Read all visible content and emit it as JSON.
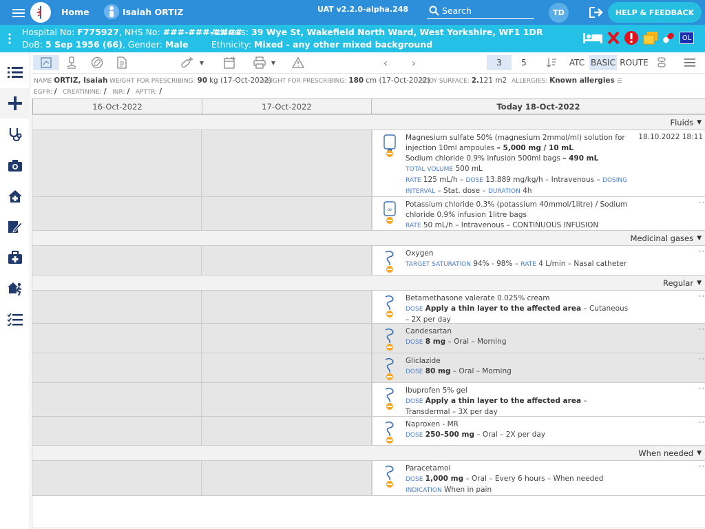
{
  "header": {
    "home_label": "Home",
    "patient_name": "Isaiah ORTIZ",
    "version": "UAT v2.2.0-alpha.248",
    "search_placeholder": "Search",
    "initials": "TD",
    "help_label": "HELP & FEEDBACK"
  },
  "patient": {
    "line1_a": "Hospital No: ",
    "hospital_no": "F775927",
    "nhs_label": ", NHS No: ",
    "nhs_no": "###-###-####",
    "address_label": "Address: ",
    "address": "39 Wye St, Wakefield North Ward, West Yorkshire, WF1 1DR",
    "dob_label": "DoB: ",
    "dob": "5 Sep 1956 (66)",
    "gender_label": ", Gender: ",
    "gender": "Male",
    "eth_label": "Ethnicity: ",
    "ethnicity": "Mixed - any other mixed background",
    "ol_badge": "OL"
  },
  "toolbar": {
    "page_a": "3",
    "page_b": "5",
    "atc": "ATC",
    "basic": "BASIC",
    "route": "ROUTE"
  },
  "info": {
    "name_label": "NAME",
    "name": "ORTIZ, Isaiah",
    "weight_label": "WEIGHT FOR PRESCRIBING:",
    "weight": "90",
    "weight_unit": "kg (17-Oct-2022)",
    "height_label": "HEIGHT FOR PRESCRIBING:",
    "height": "180",
    "height_unit": "cm (17-Oct-2022)",
    "bsa_label": "BODY SURFACE:",
    "bsa": "2.",
    "bsa_dec": "121 m2",
    "allergies_label": "ALLERGIES:",
    "allergies": "Known allergies",
    "egfr": "EGFR:",
    "creat": "CREATININE:",
    "inr": "INR:",
    "apttr": "APTTR:",
    "slash": "/"
  },
  "columns": [
    "16-Oct-2022",
    "17-Oct-2022",
    "Today 18-Oct-2022"
  ],
  "sections": {
    "fluids": "Fluids",
    "gases": "Medicinal gases",
    "regular": "Regular",
    "prn": "When needed"
  },
  "rx": {
    "mg_line1": "Magnesium sulfate 50% (magnesium 2mmol/ml) solution for injection 10ml ampoules",
    "mg_dose": "– 5,000 mg / 10 mL",
    "mg_line2": "Sodium chloride 0.9% infusion 500ml bags",
    "mg_dose2": "– 490 mL",
    "total_vol_label": "TOTAL VOLUME",
    "total_vol": "500 mL",
    "rate_label": "RATE",
    "mg_rate": "125 mL/h –",
    "dose_label": "DOSE",
    "mg_dose_val": "13.889 mg/kg/h – Intravenous –",
    "dosing_interval_label": "DOSING INTERVAL",
    "mg_interval": "– Stat. dose –",
    "duration_label": "DURATION",
    "mg_duration": "4h",
    "mg_ts": "18.10.2022 18:11",
    "k_line": "Potassium chloride 0.3% (potassium 40mmol/1litre) / Sodium chloride 0.9% infusion 1litre bags",
    "k_rate": "50 mL/h – Intravenous – CONTINUOUS INFUSION",
    "o2_name": "Oxygen",
    "target_label": "TARGET SATURATION",
    "o2_target": "94% - 98% –",
    "o2_rate": "4 L/min – Nasal catheter",
    "beta_name": "Betamethasone valerate 0.025% cream",
    "beta_dose": "Apply a thin layer to the affected area",
    "beta_rest": "– Cutaneous – 2X per day",
    "cand_name": "Candesartan",
    "cand_dose": "8 mg",
    "cand_rest": "– Oral – Morning",
    "gli_name": "Gliclazide",
    "gli_dose": "80 mg",
    "gli_rest": "– Oral – Morning",
    "ibu_name": "Ibuprofen 5% gel",
    "ibu_dose": "Apply a thin layer to the affected area",
    "ibu_rest": "– Transdermal – 3X per day",
    "nap_name": "Naproxen - MR",
    "nap_dose": "250–500 mg",
    "nap_rest": "– Oral – 2X per day",
    "para_name": "Paracetamol",
    "para_dose": "1,000 mg",
    "para_rest": "– Oral – Every 6 hours – When needed",
    "indication_label": "INDICATION",
    "para_ind": "When in pain"
  },
  "colors": {
    "topbar": "#2d8fd9",
    "patientbar": "#25c0e6",
    "accent": "#4a7fcf",
    "nav": "#1f3a6b"
  }
}
